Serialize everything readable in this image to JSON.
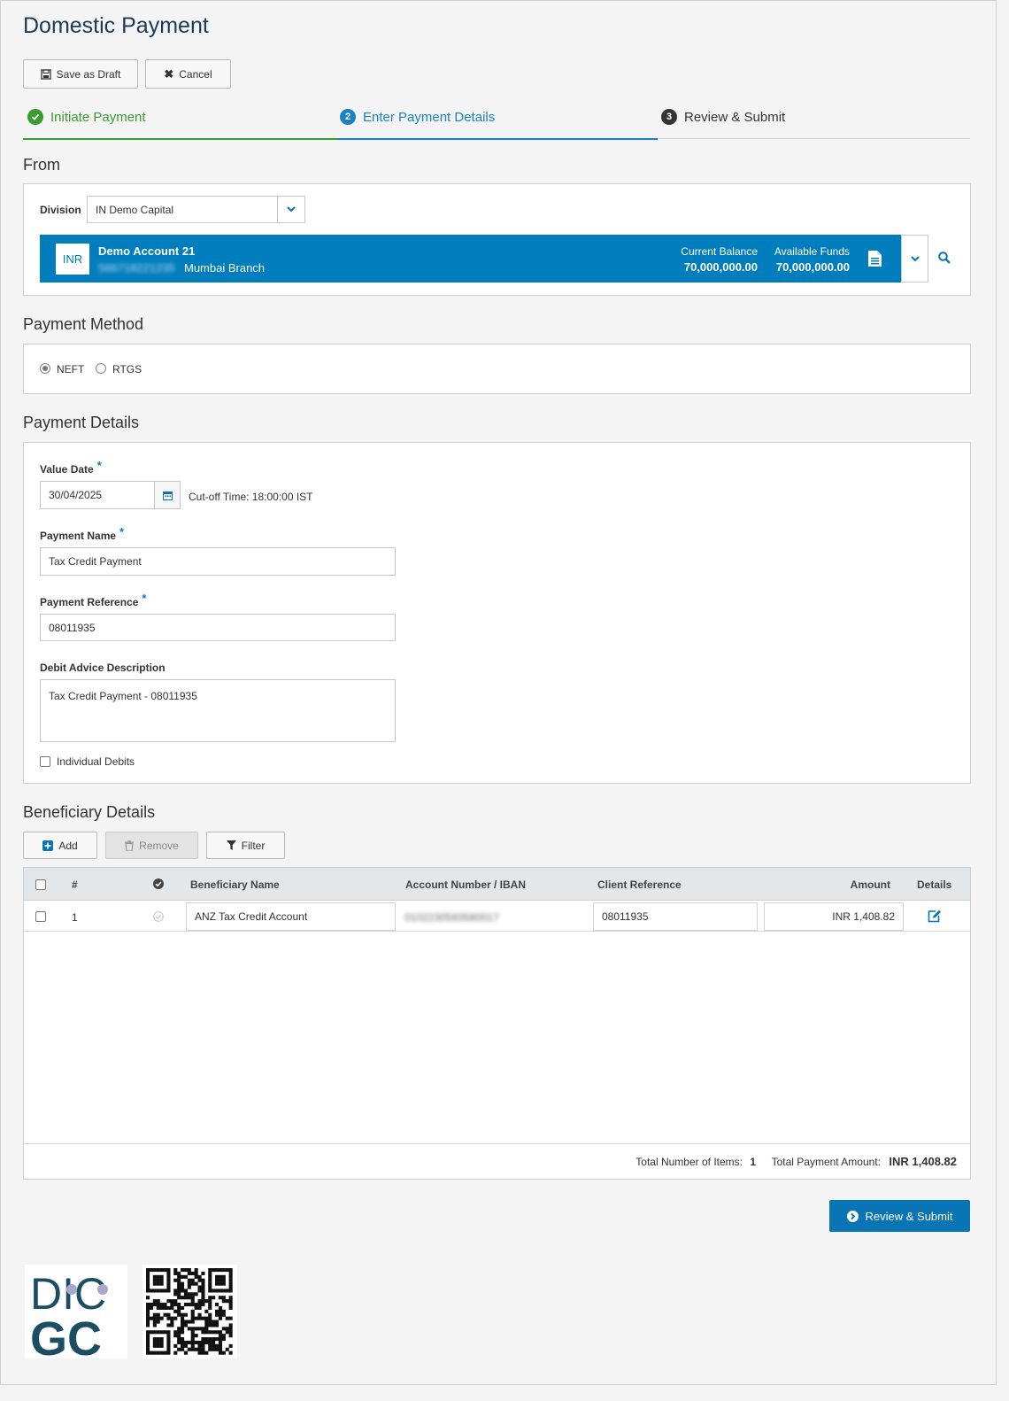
{
  "page": {
    "title": "Domestic Payment"
  },
  "toolbar": {
    "save_draft_label": "Save as Draft",
    "cancel_label": "Cancel"
  },
  "steps": [
    {
      "label": "Initiate Payment",
      "state": "done",
      "color": "#3a9b2e"
    },
    {
      "number": "2",
      "label": "Enter Payment Details",
      "state": "active",
      "color": "#1a82c4"
    },
    {
      "number": "3",
      "label": "Review & Submit",
      "state": "pending",
      "color": "#333333"
    }
  ],
  "from": {
    "title": "From",
    "division_label": "Division",
    "division_value": "IN Demo Capital",
    "account": {
      "currency": "INR",
      "name": "Demo Account 21",
      "number": "566718221235",
      "branch": "Mumbai Branch",
      "current_balance_label": "Current Balance",
      "current_balance": "70,000,000.00",
      "available_funds_label": "Available Funds",
      "available_funds": "70,000,000.00",
      "bar_color": "#007dbd"
    }
  },
  "payment_method": {
    "title": "Payment Method",
    "options": [
      {
        "label": "NEFT",
        "selected": true
      },
      {
        "label": "RTGS",
        "selected": false
      }
    ]
  },
  "payment_details": {
    "title": "Payment Details",
    "value_date_label": "Value Date",
    "value_date": "30/04/2025",
    "cutoff_text": "Cut-off Time: 18:00:00 IST",
    "payment_name_label": "Payment Name",
    "payment_name": "Tax Credit Payment",
    "payment_reference_label": "Payment Reference",
    "payment_reference": "08011935",
    "debit_advice_label": "Debit Advice Description",
    "debit_advice": "Tax Credit Payment - 08011935",
    "individual_debits_label": "Individual Debits",
    "required_mark": "*"
  },
  "beneficiary": {
    "title": "Beneficiary Details",
    "add_label": "Add",
    "remove_label": "Remove",
    "filter_label": "Filter",
    "columns": {
      "index": "#",
      "name": "Beneficiary Name",
      "account": "Account Number / IBAN",
      "client_ref": "Client Reference",
      "amount": "Amount",
      "details": "Details"
    },
    "rows": [
      {
        "index": "1",
        "name": "ANZ Tax Credit Account",
        "account": "0102230593580017",
        "client_ref": "08011935",
        "amount": "INR 1,408.82"
      }
    ],
    "footer": {
      "total_items_label": "Total Number of Items:",
      "total_items": "1",
      "total_amount_label": "Total Payment Amount:",
      "total_amount": "INR 1,408.82"
    }
  },
  "actions": {
    "review_submit_label": "Review & Submit"
  },
  "logos": {
    "dicgc_text_1": "DIC",
    "dicgc_text_2": "GC"
  },
  "colors": {
    "primary": "#0a75b5",
    "success": "#3a9b2e",
    "accent": "#007dbd"
  }
}
